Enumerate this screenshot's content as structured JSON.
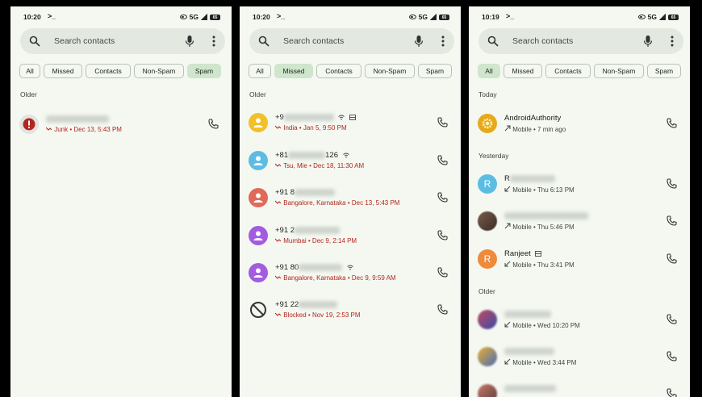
{
  "search_placeholder": "Search contacts",
  "chips": [
    "All",
    "Missed",
    "Contacts",
    "Non-Spam",
    "Spam"
  ],
  "panels": [
    {
      "time": "10:20",
      "prompt": ">_",
      "network": "5G",
      "battery": "65",
      "sections": [
        {
          "title": "Older"
        }
      ],
      "rows": [
        {
          "number": "",
          "meta": "Junk • Dec 13, 5:43 PM"
        }
      ]
    },
    {
      "time": "10:20",
      "prompt": ">_",
      "network": "5G",
      "battery": "65",
      "sections": [
        {
          "title": "Older"
        }
      ],
      "rows": [
        {
          "number": "+9",
          "meta": "India • Jan 5, 9:50 PM"
        },
        {
          "number": "+81",
          "number_suffix": "126",
          "meta": "Tsu, Mie • Dec 18, 11:30 AM"
        },
        {
          "number": "+91 8",
          "meta": "Bangalore, Karnataka • Dec 13, 5:43 PM"
        },
        {
          "number": "+91 2",
          "meta": "Mumbai • Dec 9, 2:14 PM"
        },
        {
          "number": "+91 80",
          "meta": "Bangalore, Karnataka • Dec 9, 9:59 AM"
        },
        {
          "number": "+91 22",
          "meta": "Blocked • Nov 19, 2:53 PM"
        }
      ]
    },
    {
      "time": "10:19",
      "prompt": ">_",
      "network": "5G",
      "battery": "65",
      "sections": [
        {
          "title": "Today"
        },
        {
          "title": "Yesterday"
        },
        {
          "title": "Older"
        }
      ],
      "rows": [
        {
          "name": "AndroidAuthority",
          "meta": "Mobile • 7 min ago"
        },
        {
          "initial": "R",
          "name": "R",
          "meta": "Mobile • Thu 6:13 PM"
        },
        {
          "name": "",
          "meta": "Mobile • Thu 5:46 PM"
        },
        {
          "initial": "R",
          "name": "Ranjeet",
          "meta": "Mobile • Thu 3:41 PM"
        },
        {
          "name": "",
          "meta": "Mobile • Wed 10:20 PM"
        },
        {
          "name": "",
          "meta": "Mobile • Wed 3:44 PM"
        }
      ]
    }
  ],
  "colors": {
    "selected_chip": "#cfe5cc",
    "missed": "#b3261e",
    "background": "#f4f8f1"
  }
}
